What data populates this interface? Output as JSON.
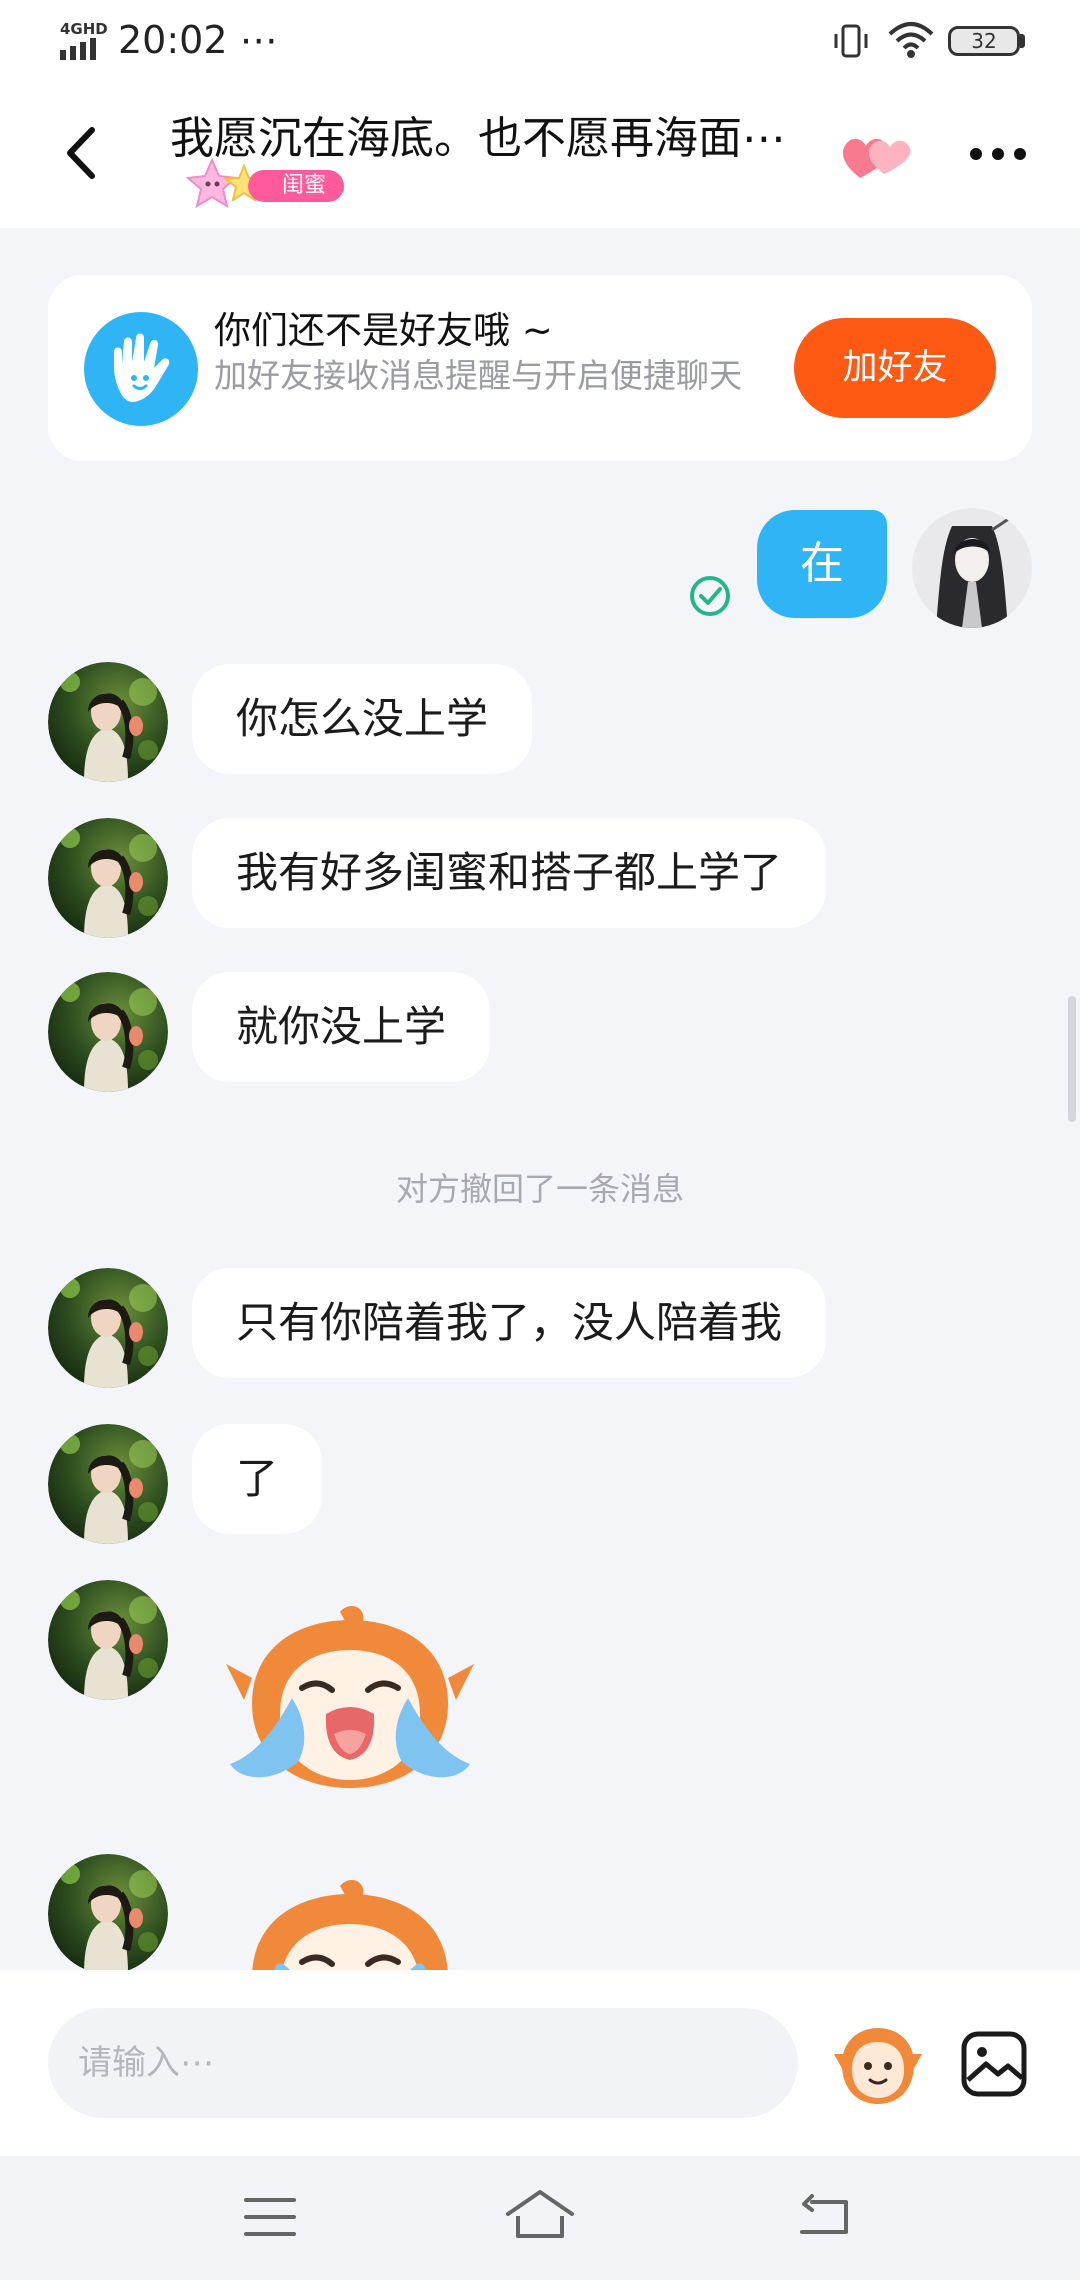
{
  "status_bar": {
    "time": "20:02 ⋯",
    "network": "4GHD",
    "battery": "32"
  },
  "nav": {
    "title": "我愿沉在海底。也不愿再海面⋯",
    "tag": "闺蜜"
  },
  "banner": {
    "title": "你们还不是好友哦 ~",
    "subtitle": "加好友接收消息提醒与开启便捷聊天",
    "button": "加好友"
  },
  "messages": {
    "out_1": "在",
    "in_1": "你怎么没上学",
    "in_2": "我有好多闺蜜和搭子都上学了",
    "in_3": "就你没上学",
    "recall_notice": "对方撤回了一条消息",
    "in_4": "只有你陪着我了，没人陪着我",
    "in_5": "了"
  },
  "input": {
    "placeholder": "请输入⋯"
  },
  "colors": {
    "accent_blue": "#2fb4f5",
    "add_friend_orange": "#fe5a13",
    "read_check": "#25b58a",
    "tag_pink": "#ff5a9a"
  },
  "icons": [
    "back-arrow-icon",
    "hearts-icon",
    "more-dots-icon",
    "wave-hand-icon",
    "read-check-icon",
    "sticker-face-icon",
    "image-icon",
    "menu-lines-icon",
    "home-icon",
    "back-nav-icon"
  ]
}
